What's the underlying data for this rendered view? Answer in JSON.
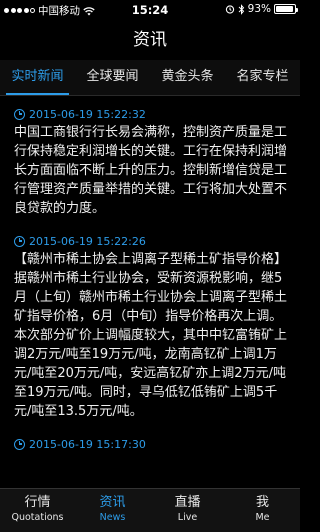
{
  "status_bar": {
    "carrier": "中国移动",
    "time": "15:24",
    "battery": "93%",
    "battery_level": 0.93,
    "icons": [
      "signal-dots",
      "wifi-icon",
      "alarm-icon",
      "bluetooth-icon",
      "battery-icon"
    ]
  },
  "nav": {
    "title": "资讯"
  },
  "tabs": [
    {
      "label": "实时新闻",
      "active": true
    },
    {
      "label": "全球要闻",
      "active": false
    },
    {
      "label": "黄金头条",
      "active": false
    },
    {
      "label": "名家专栏",
      "active": false
    }
  ],
  "news": [
    {
      "time": "2015-06-19 15:22:32",
      "body": "中国工商银行行长易会满称，控制资产质量是工行保持稳定利润增长的关键。工行在保持利润增长方面面临不断上升的压力。控制新增信贷是工行管理资产质量举措的关键。工行将加大处置不良贷款的力度。"
    },
    {
      "time": "2015-06-19 15:22:26",
      "body": "【赣州市稀土协会上调离子型稀土矿指导价格】据赣州市稀土行业协会，受新资源税影响，继5月（上旬）赣州市稀土行业协会上调离子型稀土矿指导价格，6月（中旬）指导价格再次上调。本次部分矿价上调幅度较大，其中中钇富铕矿上调2万元/吨至19万元/吨，龙南高钇矿上调1万元/吨至20万元/吨，安远高钇矿亦上调2万元/吨至19万元/吨。同时，寻乌低钇低铕矿上调5千元/吨至13.5万元/吨。"
    },
    {
      "time": "2015-06-19 15:17:30",
      "body": ""
    }
  ],
  "accent_color": "#2d9ce8",
  "bottom_tabs": [
    {
      "cn": "行情",
      "en": "Quotations",
      "active": false
    },
    {
      "cn": "资讯",
      "en": "News",
      "active": true
    },
    {
      "cn": "直播",
      "en": "Live",
      "active": false
    },
    {
      "cn": "我",
      "en": "Me",
      "active": false
    }
  ]
}
